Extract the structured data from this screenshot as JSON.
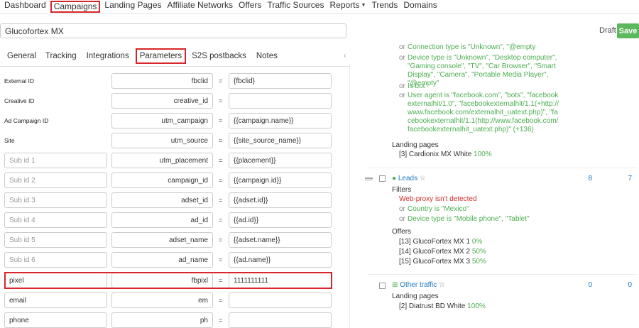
{
  "nav": [
    {
      "label": "Dashboard"
    },
    {
      "label": "Campaigns"
    },
    {
      "label": "Landing Pages"
    },
    {
      "label": "Affiliate Networks"
    },
    {
      "label": "Offers"
    },
    {
      "label": "Traffic Sources"
    },
    {
      "label": "Reports"
    },
    {
      "label": "Trends"
    },
    {
      "label": "Domains"
    }
  ],
  "campaign": {
    "name": "Glucofortex MX",
    "status": "Draft",
    "save_label": "Save"
  },
  "tabs": [
    {
      "label": "General"
    },
    {
      "label": "Tracking"
    },
    {
      "label": "Integrations"
    },
    {
      "label": "Parameters"
    },
    {
      "label": "S2S postbacks"
    },
    {
      "label": "Notes"
    }
  ],
  "equals": "=",
  "params": [
    {
      "label": "External ID",
      "key": "fbclid",
      "value": "{fbclid}"
    },
    {
      "label": "Creative ID",
      "key": "creative_id",
      "value": ""
    },
    {
      "label": "Ad Campaign ID",
      "key": "utm_campaign",
      "value": "{{campaign.name}}"
    },
    {
      "label": "Site",
      "key": "utm_source",
      "value": "{{site_source_name}}"
    },
    {
      "placeholder": "Sub id 1",
      "key": "utm_placement",
      "value": "{{placement}}"
    },
    {
      "placeholder": "Sub id 2",
      "key": "campaign_id",
      "value": "{{campaign.id}}"
    },
    {
      "placeholder": "Sub id 3",
      "key": "adset_id",
      "value": "{{adset.id}}"
    },
    {
      "placeholder": "Sub id 4",
      "key": "ad_id",
      "value": "{{ad.id}}"
    },
    {
      "placeholder": "Sub id 5",
      "key": "adset_name",
      "value": "{{adset.name}}"
    },
    {
      "placeholder": "Sub id 6",
      "key": "ad_name",
      "value": "{{ad.name}}"
    },
    {
      "name": "pixel",
      "key": "fbpixl",
      "value": "1111111111"
    },
    {
      "name": "email",
      "key": "em",
      "value": ""
    },
    {
      "name": "phone",
      "key": "ph",
      "value": ""
    }
  ],
  "flow": {
    "or": "or",
    "cut_line": "Connection type is \"Unknown\", \"@empty",
    "conditions_top": [
      "Device type is \"Unknown\", \"Desktop computer\", \"Gaming console\", \"TV\", \"Car Browser\", \"Smart Display\", \"Camera\", \"Portable Media Player\", \"@empty\"",
      "Is bot",
      "User agent is \"facebook.com\", \"bots\", \"facebookexternalhit/1.0\", \"facebookexternalhit/1.1(+http://www.facebook.com/externalhit_uatext.php)\", \"facebookexternalhit/1.1(http://www.facebook.com/facebookexternalhit_uatext.php)\" (+136)"
    ],
    "landing_pages_label": "Landing pages",
    "lp_top": {
      "name": "[3] Cardionix MX White",
      "pct": "100%"
    },
    "leads": {
      "dot": "●",
      "name": "Leads",
      "star": "☆",
      "count_a": "8",
      "count_b": "7",
      "filters_label": "Filters",
      "filter_red": "Web-proxy isn't detected",
      "filter_2": "Country is \"Mexico\"",
      "filter_3": "Device type is \"Mobile phone\", \"Tablet\"",
      "offers_label": "Offers",
      "offers": [
        {
          "name": "[13] GlucoFortex MX 1",
          "pct": "0%"
        },
        {
          "name": "[14] GlucoFortex MX 2",
          "pct": "50%"
        },
        {
          "name": "[15] GlucoFortex MX 3",
          "pct": "50%"
        }
      ]
    },
    "other": {
      "expand": "⊞",
      "name": "Other traffic",
      "star": "☆",
      "count_a": "0",
      "count_b": "0",
      "landing_pages_label": "Landing pages",
      "lp": {
        "name": "[2] Diatrust BD White",
        "pct": "100%"
      }
    }
  }
}
